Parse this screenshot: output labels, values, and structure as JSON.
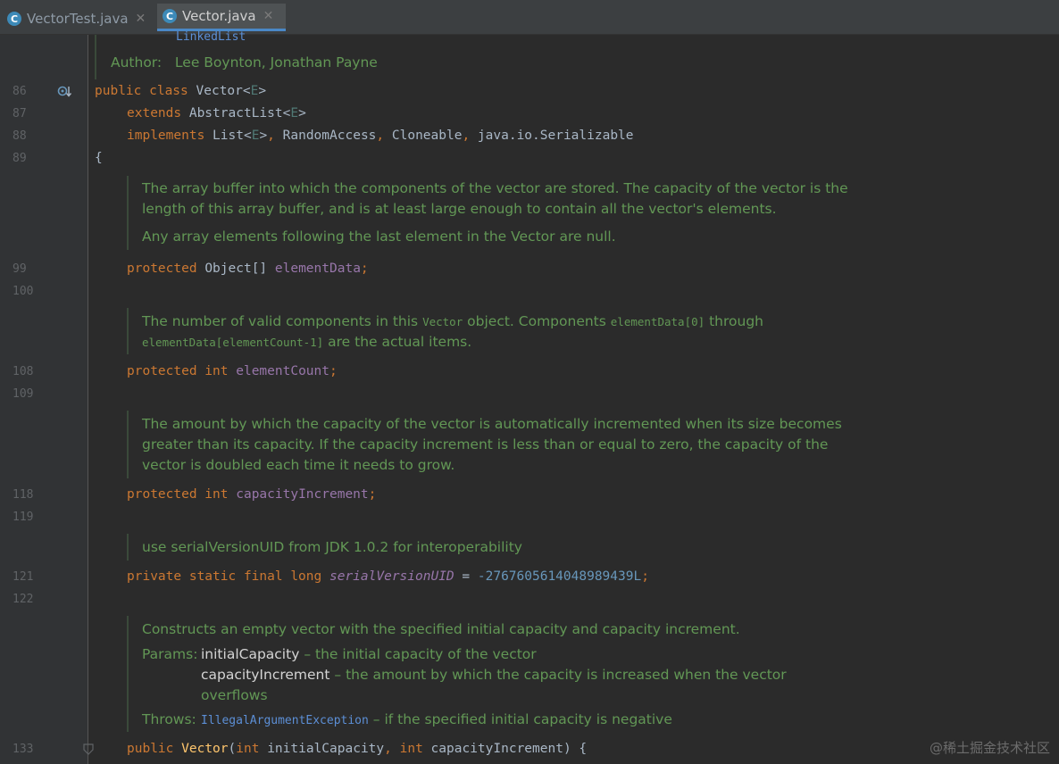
{
  "tabs": [
    {
      "label": "VectorTest.java",
      "icon": "C",
      "active": false
    },
    {
      "label": "Vector.java",
      "icon": "C",
      "active": true
    }
  ],
  "close_glyph": "✕",
  "line_numbers": [
    "86",
    "87",
    "88",
    "89",
    "99",
    "100",
    "108",
    "109",
    "118",
    "119",
    "121",
    "122",
    "133"
  ],
  "header_doc": {
    "link": "LinkedList",
    "author_label": "Author:",
    "author_value": "Lee Boynton, Jonathan Payne"
  },
  "code": {
    "l86": {
      "kw": "public class",
      "name": "Vector",
      "lt": "<",
      "tp": "E",
      "gt": ">"
    },
    "l87": {
      "kw": "extends",
      "name": "AbstractList",
      "lt": "<",
      "tp": "E",
      "gt": ">"
    },
    "l88": {
      "kw": "implements",
      "a": "List",
      "lt": "<",
      "tp": "E",
      "gt": ">",
      "c1": ",",
      "b": "RandomAccess",
      "c2": ",",
      "c": "Cloneable",
      "c3": ",",
      "d": "java.io.Serializable"
    },
    "l89": "{",
    "l99": {
      "kw": "protected",
      "type": "Object[]",
      "field": "elementData",
      "semi": ";"
    },
    "l108": {
      "kw": "protected int",
      "field": "elementCount",
      "semi": ";"
    },
    "l118": {
      "kw": "protected int",
      "field": "capacityIncrement",
      "semi": ";"
    },
    "l121": {
      "kw": "private static final long",
      "field": "serialVersionUID",
      "eq": "=",
      "num": "-2767605614048989439L",
      "semi": ";"
    },
    "l133": {
      "kw": "public",
      "name": "Vector",
      "p1": "(",
      "k1": "int",
      "a1": "initialCapacity",
      "c": ",",
      "k2": "int",
      "a2": "capacityIncrement",
      "p2": ")",
      "brace": "{"
    }
  },
  "docs": {
    "d1_line1": "The array buffer into which the components of the vector are stored. The capacity of the vector is the",
    "d1_line2": "length of this array buffer, and is at least large enough to contain all the vector's elements.",
    "d1_line3": "Any array elements following the last element in the Vector are null.",
    "d2_a": "The number of valid components in this",
    "d2_code1": "Vector",
    "d2_b": "object. Components",
    "d2_code2": "elementData[0]",
    "d2_c": "through",
    "d2_code3": "elementData[elementCount-1]",
    "d2_d": "are the actual items.",
    "d3_line1": "The amount by which the capacity of the vector is automatically incremented when its size becomes",
    "d3_line2": "greater than its capacity. If the capacity increment is less than or equal to zero, the capacity of the",
    "d3_line3": "vector is doubled each time it needs to grow.",
    "d4": "use serialVersionUID from JDK 1.0.2 for interoperability",
    "d5_line1": "Constructs an empty vector with the specified initial capacity and capacity increment.",
    "d5_params_label": "Params:",
    "d5_p1_name": "initialCapacity",
    "d5_p1_desc": "– the initial capacity of the vector",
    "d5_p2_name": "capacityIncrement",
    "d5_p2_desc": "– the amount by which the capacity is increased when the vector",
    "d5_p2_desc2": "overflows",
    "d5_throws_label": "Throws:",
    "d5_throws_link": "IllegalArgumentException",
    "d5_throws_desc": "– if the specified initial capacity is negative"
  },
  "watermark": "@稀土掘金技术社区"
}
